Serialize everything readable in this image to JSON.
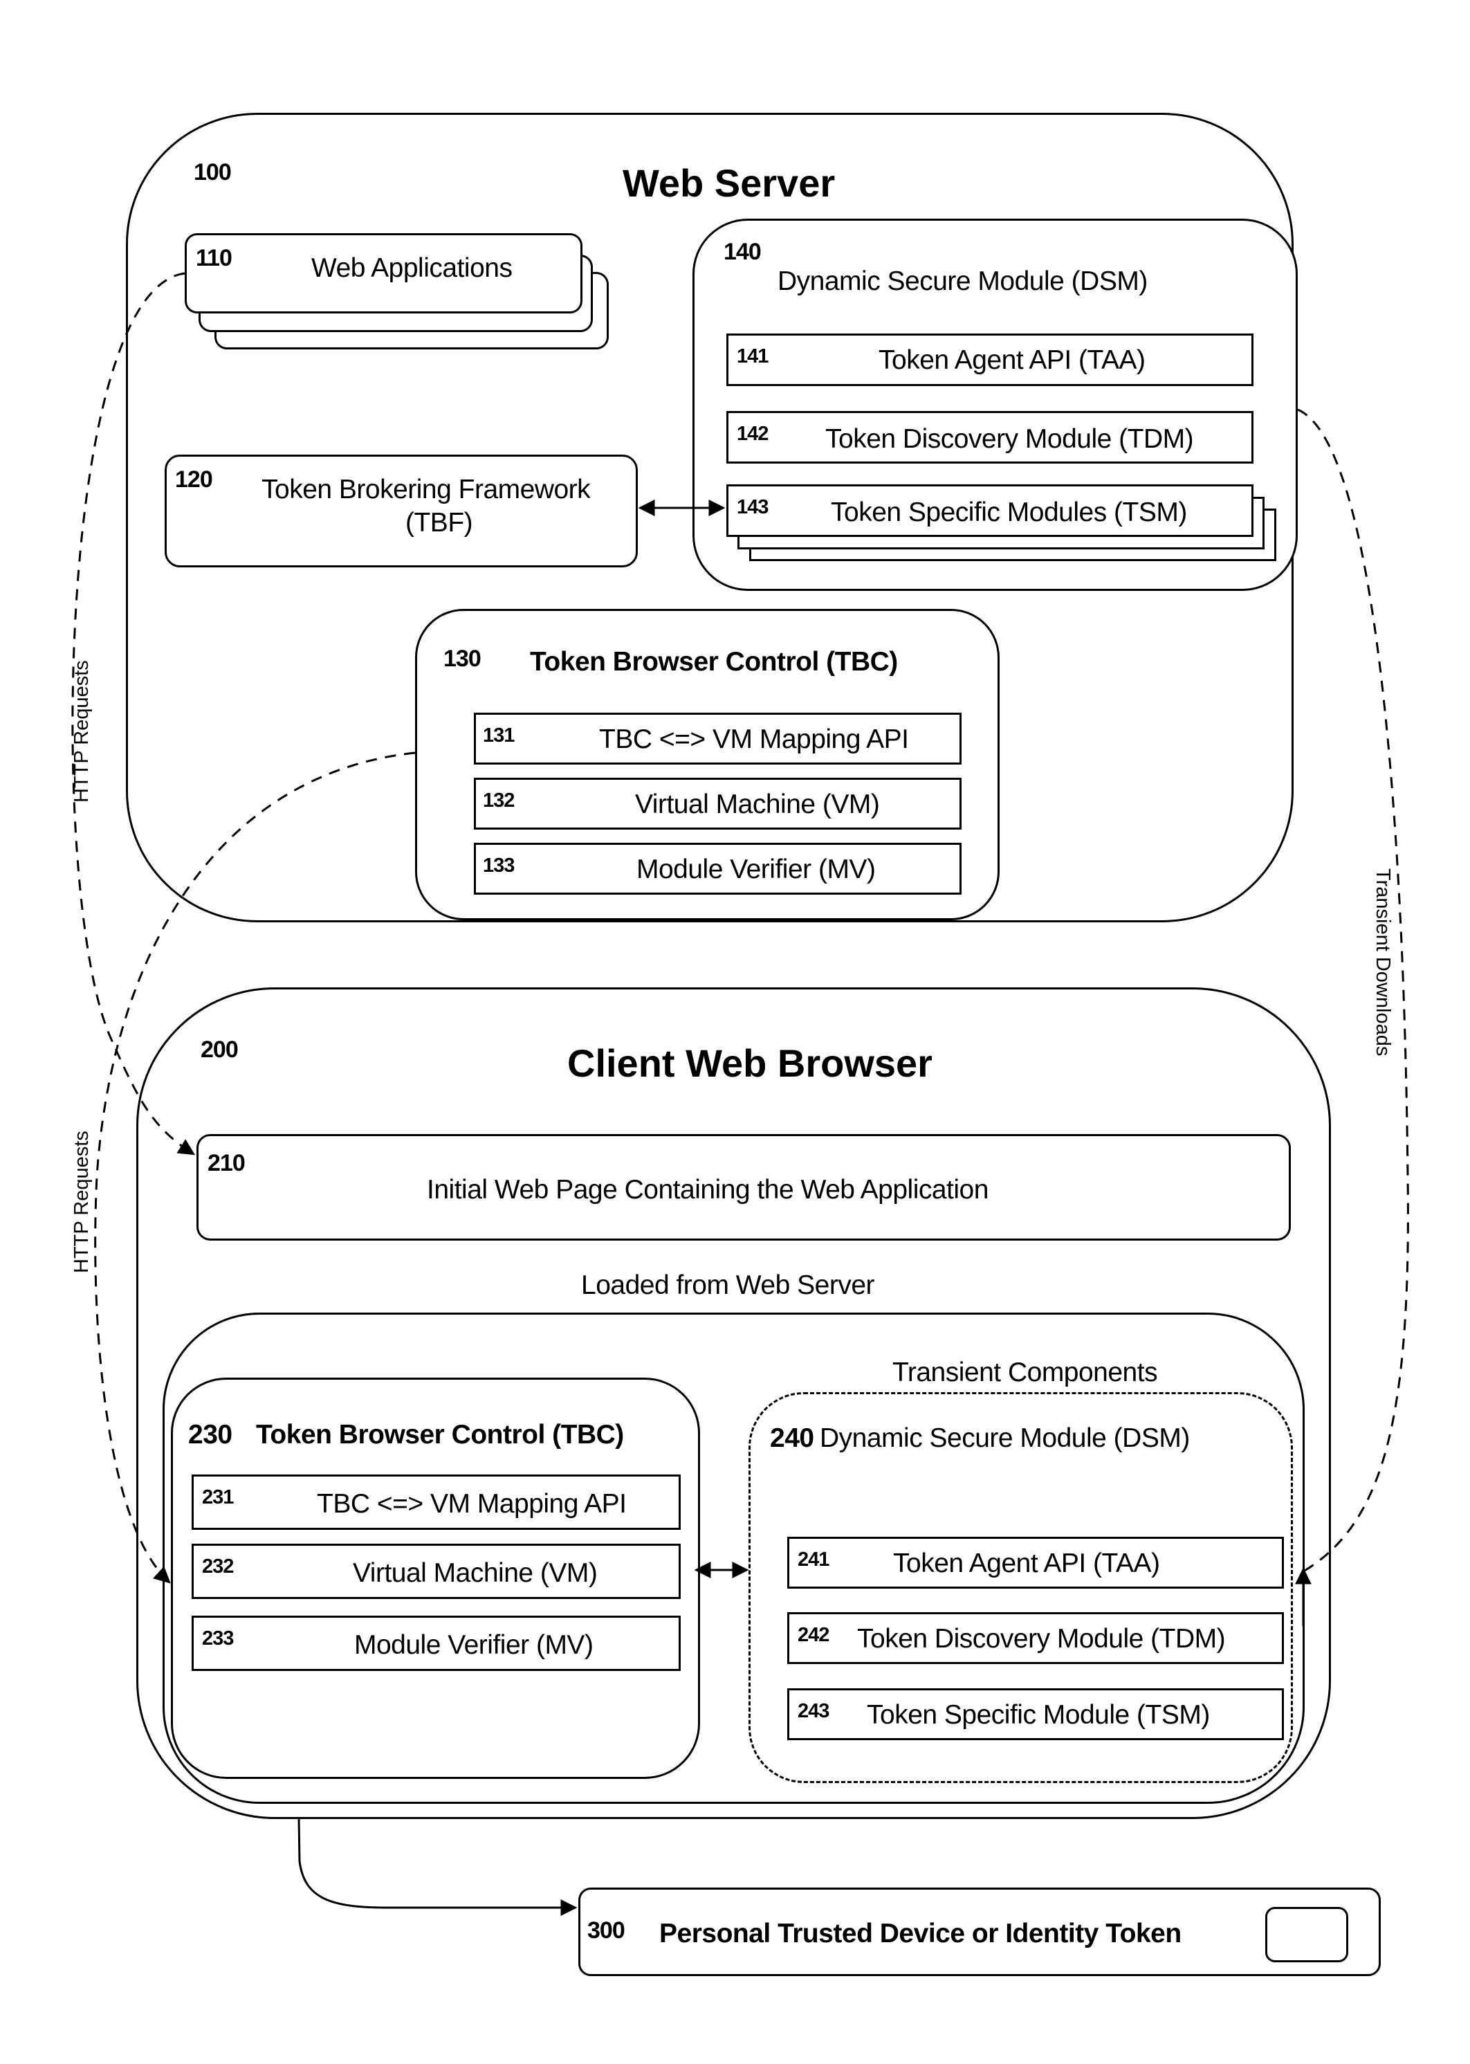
{
  "web_server": {
    "ref": "100",
    "title": "Web Server",
    "web_applications": {
      "ref": "110",
      "label": "Web Applications"
    },
    "tbf": {
      "ref": "120",
      "label_line1": "Token Brokering Framework",
      "label_line2": "(TBF)"
    },
    "tbc": {
      "ref": "130",
      "title": "Token Browser Control (TBC)",
      "items": [
        {
          "ref": "131",
          "label": "TBC <=> VM Mapping API"
        },
        {
          "ref": "132",
          "label": "Virtual Machine (VM)"
        },
        {
          "ref": "133",
          "label": "Module Verifier (MV)"
        }
      ]
    },
    "dsm": {
      "ref": "140",
      "title": "Dynamic Secure Module (DSM)",
      "items": [
        {
          "ref": "141",
          "label": "Token Agent API (TAA)"
        },
        {
          "ref": "142",
          "label": "Token Discovery Module (TDM)"
        },
        {
          "ref": "143",
          "label": "Token Specific Modules (TSM)"
        }
      ]
    }
  },
  "client_browser": {
    "ref": "200",
    "title": "Client Web Browser",
    "initial_page": {
      "ref": "210",
      "label": "Initial Web Page Containing the Web Application"
    },
    "loaded_label": "Loaded from Web Server",
    "transient_label": "Transient Components",
    "tbc": {
      "ref": "230",
      "title": "Token Browser Control (TBC)",
      "items": [
        {
          "ref": "231",
          "label": "TBC <=> VM Mapping API"
        },
        {
          "ref": "232",
          "label": "Virtual Machine (VM)"
        },
        {
          "ref": "233",
          "label": "Module Verifier (MV)"
        }
      ]
    },
    "dsm": {
      "ref": "240",
      "title": "Dynamic Secure Module (DSM)",
      "items": [
        {
          "ref": "241",
          "label": "Token Agent API (TAA)"
        },
        {
          "ref": "242",
          "label": "Token Discovery Module (TDM)"
        },
        {
          "ref": "243",
          "label": "Token Specific Module (TSM)"
        }
      ]
    }
  },
  "device": {
    "ref": "300",
    "label": "Personal Trusted Device or Identity Token"
  },
  "connectors": {
    "http_requests_1": "HTTP Requests",
    "http_requests_2": "HTTP Requests",
    "transient_downloads": "Transient Downloads"
  }
}
